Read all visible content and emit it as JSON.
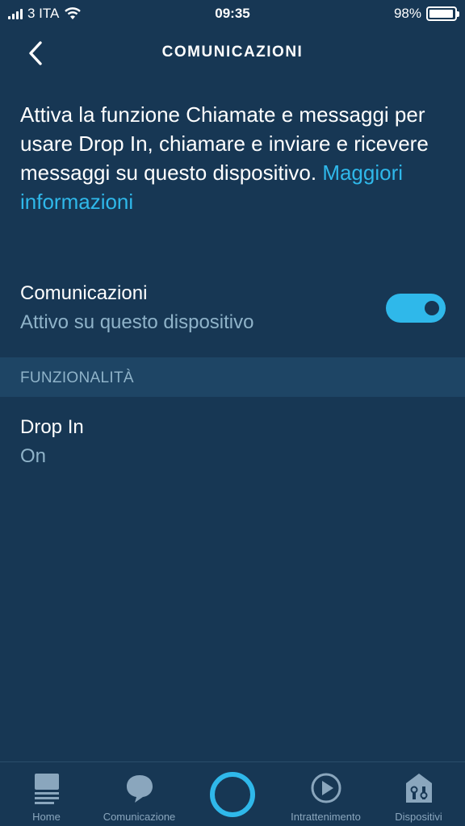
{
  "status_bar": {
    "carrier": "3 ITA",
    "time": "09:35",
    "battery": "98%",
    "battery_level": 0.98
  },
  "header": {
    "title": "COMUNICAZIONI",
    "back_icon": "chevron-left-icon"
  },
  "intro": {
    "text": "Attiva la funzione Chiamate e messaggi per usare Drop In, chiamare e inviare e ricevere messaggi su questo dispositivo. ",
    "link": "Maggiori informazioni"
  },
  "communications": {
    "title": "Comunicazioni",
    "subtitle": "Attivo su questo dispositivo",
    "enabled": true
  },
  "section": {
    "label": "FUNZIONALITÀ"
  },
  "drop_in": {
    "title": "Drop In",
    "status": "On"
  },
  "nav": {
    "items": [
      {
        "label": "Home",
        "icon": "home-icon"
      },
      {
        "label": "Comunicazione",
        "icon": "speech-bubble-icon"
      },
      {
        "label": "",
        "icon": "alexa-ring-icon"
      },
      {
        "label": "Intrattenimento",
        "icon": "play-icon"
      },
      {
        "label": "Dispositivi",
        "icon": "devices-icon"
      }
    ]
  },
  "colors": {
    "background": "#173754",
    "accent": "#2fb8ea",
    "section_bg": "#1e4565",
    "muted_text": "#8fb3c9"
  }
}
